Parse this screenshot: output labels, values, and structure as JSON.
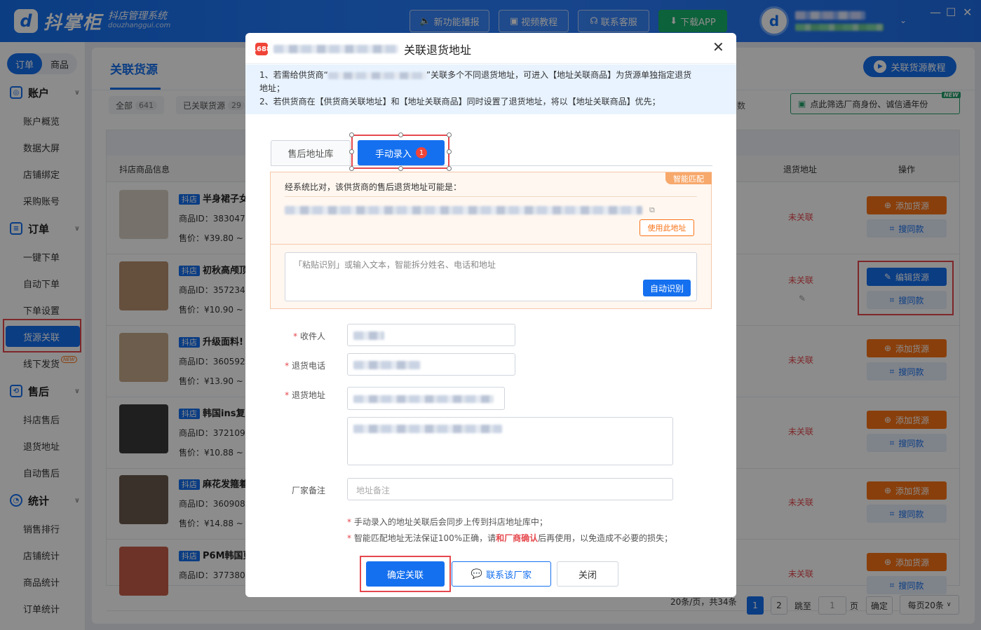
{
  "topbar": {
    "logo_name": "抖掌柜",
    "logo_tagline": "抖店管理系统",
    "logo_domain": "douzhanggui.com",
    "buttons": [
      "新功能播报",
      "视频教程",
      "联系客服",
      "下载APP"
    ],
    "window_controls": [
      "—",
      "☐",
      "✕"
    ]
  },
  "sidebar": {
    "segment": [
      "订单",
      "商品"
    ],
    "groups": [
      {
        "label": "账户",
        "items": [
          "账户概览",
          "数据大屏",
          "店铺绑定",
          "采购账号"
        ]
      },
      {
        "label": "订单",
        "items": [
          "一键下单",
          "自动下单",
          "下单设置",
          "货源关联",
          "线下发货"
        ]
      },
      {
        "label": "售后",
        "items": [
          "抖店售后",
          "退货地址",
          "自动售后"
        ]
      },
      {
        "label": "统计",
        "items": [
          "销售排行",
          "店铺统计",
          "商品统计",
          "订单统计"
        ]
      }
    ],
    "new_tag": "NEW"
  },
  "page": {
    "title": "关联货源",
    "tutorial_button": "关联货源教程",
    "filter_tabs": [
      {
        "label": "全部",
        "count": "641"
      },
      {
        "label": "已关联货源",
        "count": "29"
      }
    ],
    "filter_button": "点此筛选厂商身份、诚信通年份",
    "filter_badge": "NEW",
    "col_product": "抖店商品信息",
    "col_return": "退货地址",
    "col_ops": "操作",
    "partial_col_text": "数"
  },
  "rows": [
    {
      "tag": "抖店",
      "name": "半身裙子女",
      "id_label": "商品ID：383047",
      "price": "售价：¥39.80 ~",
      "status": "未关联",
      "op1": "添加货源",
      "op2": "搜同款",
      "thumb_color": "#d8cfc4"
    },
    {
      "tag": "抖店",
      "name": "初秋高颅顶",
      "id_label": "商品ID：357234",
      "price": "售价：¥10.90 ~",
      "status": "未关联",
      "op1": "编辑货源",
      "op2": "搜同款",
      "thumb_color": "#b9906f"
    },
    {
      "tag": "抖店",
      "name": "升级面料!",
      "id_label": "商品ID：360592",
      "price": "售价：¥13.90 ~",
      "status": "未关联",
      "op1": "添加货源",
      "op2": "搜同款",
      "thumb_color": "#c7a98a"
    },
    {
      "tag": "抖店",
      "name": "韩国ins复",
      "id_label": "商品ID：372109",
      "price": "售价：¥10.88 ~",
      "status": "未关联",
      "op1": "添加货源",
      "op2": "搜同款",
      "thumb_color": "#3a3a3a"
    },
    {
      "tag": "抖店",
      "name": "麻花发箍着",
      "id_label": "商品ID：360908",
      "price": "售价：¥14.88 ~",
      "status": "未关联",
      "op1": "添加货源",
      "op2": "搜同款",
      "thumb_color": "#6b5a4e"
    },
    {
      "tag": "抖店",
      "name": "P6M韩国更",
      "id_label": "商品ID：377380",
      "price": "",
      "status": "未关联",
      "op1": "添加货源",
      "op2": "搜同款",
      "thumb_color": "#c65d4a"
    }
  ],
  "pagination": {
    "summary": "20条/页，共34条",
    "pages": [
      "1",
      "2"
    ],
    "goto_label": "跳至",
    "goto_value": "1",
    "page_suffix": "页",
    "confirm": "确定",
    "page_size": "每页20条"
  },
  "modal": {
    "title": "关联退货地址",
    "notice_1a": "1、若需给供货商“",
    "notice_1b": "”关联多个不同退货地址，可进入【地址关联商品】为货源单独指定退货",
    "notice_1c": "地址；",
    "notice_2": "2、若供货商在【供货商关联地址】和【地址关联商品】同时设置了退货地址，将以【地址关联商品】优先；",
    "tabs": [
      "售后地址库",
      "手动录入"
    ],
    "tab_badge": "1",
    "smart_label": "智能匹配",
    "compare_text": "经系统比对，该供货商的售后退货地址可能是：",
    "use_address_button": "使用此地址",
    "paste_placeholder": "「粘贴识别」或输入文本，智能拆分姓名、电话和地址",
    "auto_recognize_button": "自动识别",
    "fields": {
      "receiver_label": "收件人",
      "phone_label": "退货电话",
      "address_label": "退货地址",
      "remark_label": "厂家备注",
      "remark_placeholder": "地址备注"
    },
    "note_1": "手动录入的地址关联后会同步上传到抖店地址库中；",
    "note_2a": "智能匹配地址无法保证100%正确，请",
    "note_2b": "和厂商确认",
    "note_2c": "后再使用，以免造成不必要的损失；",
    "confirm_button": "确定关联",
    "contact_button": "联系该厂家",
    "close_button": "关闭"
  }
}
